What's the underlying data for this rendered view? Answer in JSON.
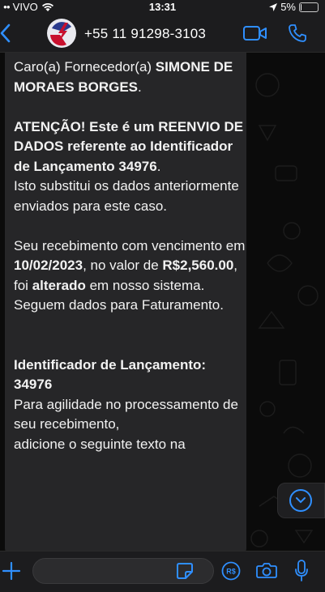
{
  "status": {
    "carrier": "VIVO",
    "time": "13:31",
    "battery": "5%",
    "battery_level": 0.05
  },
  "header": {
    "contact": "+55 11 91298-3103"
  },
  "message": {
    "greeting": "Caro(a) Fornecedor(a)",
    "supplier_name": "SIMONE DE MORAES BORGES",
    "period": ".",
    "alert_text": "ATENÇÃO! Este é um REENVIO DE DADOS referente ao Identificador de Lançamento 34976",
    "alert_end": ".",
    "replace_text": "Isto substitui os dados anteriormente enviados para este caso.",
    "due_prefix": "Seu recebimento com vencimento em",
    "due_date": "10/02/2023",
    "value_prefix": ", no valor de",
    "amount": "R$2,560.00",
    "foi": ", foi",
    "changed": "alterado",
    "changed_suffix": " em nosso sistema.",
    "followup": "Seguem dados para Faturamento.",
    "id_label": "Identificador de Lançamento:",
    "id_value": "34976",
    "agility": "Para agilidade no processamento de seu recebimento,",
    "add_text": "adicione o seguinte texto na"
  },
  "composer": {
    "value": "",
    "placeholder": ""
  },
  "colors": {
    "accent": "#2f8fff",
    "bubble": "#262628",
    "bar": "#1c1c1e"
  },
  "icons": [
    "wifi-icon",
    "location-arrow-icon",
    "battery-icon",
    "back-icon",
    "avatar",
    "video-call-icon",
    "phone-icon",
    "scroll-down-icon",
    "plus-icon",
    "sticker-icon",
    "payment-icon",
    "camera-icon",
    "microphone-icon"
  ]
}
